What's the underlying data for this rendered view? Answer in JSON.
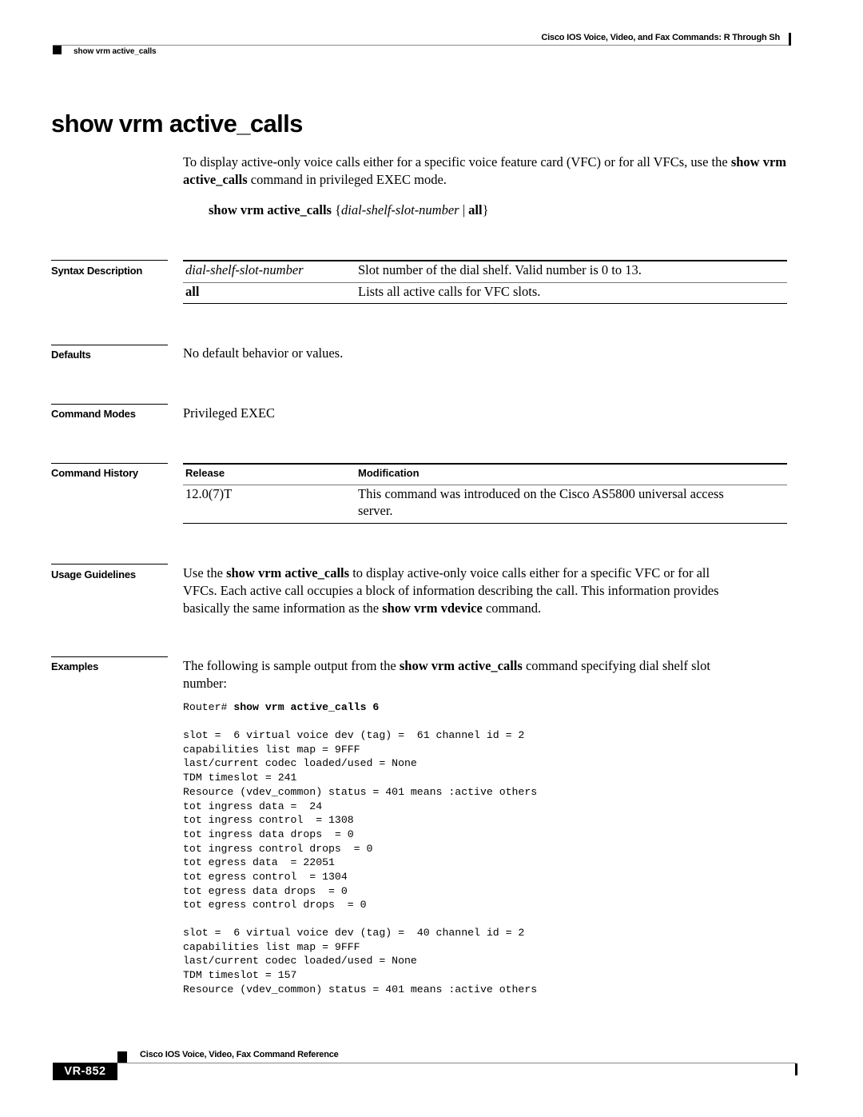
{
  "header": {
    "book_title": "Cisco IOS Voice, Video, and Fax Commands: R Through Sh",
    "section": "show vrm active_calls"
  },
  "page_title": "show vrm active_calls",
  "intro": {
    "text_1": "To display active-only voice calls either for a specific voice feature card (VFC) or for all VFCs, use the ",
    "cmd": "show vrm active_calls",
    "text_2": " command in privileged EXEC mode."
  },
  "syntax": {
    "cmd": "show vrm active_calls",
    "open": " {",
    "arg": "dial-shelf-slot-number",
    "sep": " | ",
    "kw": "all",
    "close": "}"
  },
  "sections": {
    "syntax_description": "Syntax Description",
    "defaults": "Defaults",
    "command_modes": "Command Modes",
    "command_history": "Command History",
    "usage_guidelines": "Usage Guidelines",
    "examples": "Examples"
  },
  "syntax_table": [
    {
      "param": "dial-shelf-slot-number",
      "desc": "Slot number of the dial shelf. Valid number is 0 to 13."
    },
    {
      "param": "all",
      "desc": "Lists all active calls for VFC slots."
    }
  ],
  "defaults_text": "No default behavior or values.",
  "command_modes_text": "Privileged EXEC",
  "history_table": {
    "headers": [
      "Release",
      "Modification"
    ],
    "rows": [
      {
        "release": "12.0(7)T",
        "modification_line1": "This command was introduced on the Cisco AS5800 universal access",
        "modification_line2": "server."
      }
    ]
  },
  "usage": {
    "t1": "Use the ",
    "c1": "show vrm active_calls",
    "t2": " to display active-only voice calls either for a specific VFC or for all",
    "line2": "VFCs. Each active call occupies a block of information describing the call. This information provides",
    "t3": "basically the same information as the ",
    "c2": "show vrm vdevice",
    "t4": " command."
  },
  "examples": {
    "t1": "The following is sample output from the ",
    "c1": "show vrm active_calls",
    "t2": " command specifying dial shelf slot",
    "line2": "number:",
    "prompt": "Router# ",
    "command": "show vrm active_calls 6",
    "output_block_1": [
      "slot =  6 virtual voice dev (tag) =  61 channel id = 2",
      "capabilities list map = 9FFF",
      "last/current codec loaded/used = None",
      "TDM timeslot = 241",
      "Resource (vdev_common) status = 401 means :active others",
      "tot ingress data =  24",
      "tot ingress control  = 1308",
      "tot ingress data drops  = 0",
      "tot ingress control drops  = 0",
      "tot egress data  = 22051",
      "tot egress control  = 1304",
      "tot egress data drops  = 0",
      "tot egress control drops  = 0"
    ],
    "output_block_2": [
      "slot =  6 virtual voice dev (tag) =  40 channel id = 2",
      "capabilities list map = 9FFF",
      "last/current codec loaded/used = None",
      "TDM timeslot = 157",
      "Resource (vdev_common) status = 401 means :active others"
    ]
  },
  "footer": {
    "book_title": "Cisco IOS Voice, Video, Fax Command Reference",
    "page_number": "VR-852"
  }
}
